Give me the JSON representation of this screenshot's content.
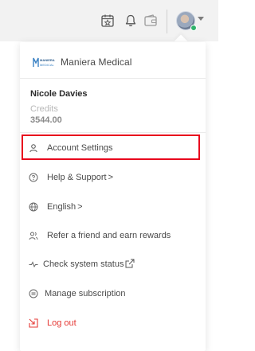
{
  "topbar": {
    "icons": [
      "calendar-star-icon",
      "bell-icon",
      "wallet-icon"
    ],
    "avatar_status_color": "#2fb36b"
  },
  "brand": {
    "logo_text_top": "MANIERA",
    "logo_text_bottom": "MEDICAL",
    "name": "Maniera Medical"
  },
  "user": {
    "name": "Nicole Davies",
    "credits_label": "Credits",
    "credits_value": "3544.00"
  },
  "menu": [
    {
      "label": "Account Settings",
      "icon": "user-icon"
    },
    {
      "label": "Help & Support",
      "suffix": ">",
      "icon": "help-circle-icon"
    },
    {
      "label": "English",
      "suffix": ">",
      "icon": "globe-icon"
    },
    {
      "label": "Refer a friend and earn rewards",
      "icon": "users-icon"
    },
    {
      "label": "Check system status",
      "icon": "pulse-icon",
      "suffix_icon": "external-link-icon"
    },
    {
      "label": "Manage subscription",
      "icon": "subscription-icon"
    },
    {
      "label": "Log out",
      "icon": "logout-icon"
    }
  ],
  "colors": {
    "highlight_border": "#e8001c",
    "logout": "#e53935",
    "brand_blue": "#3b82c4"
  }
}
